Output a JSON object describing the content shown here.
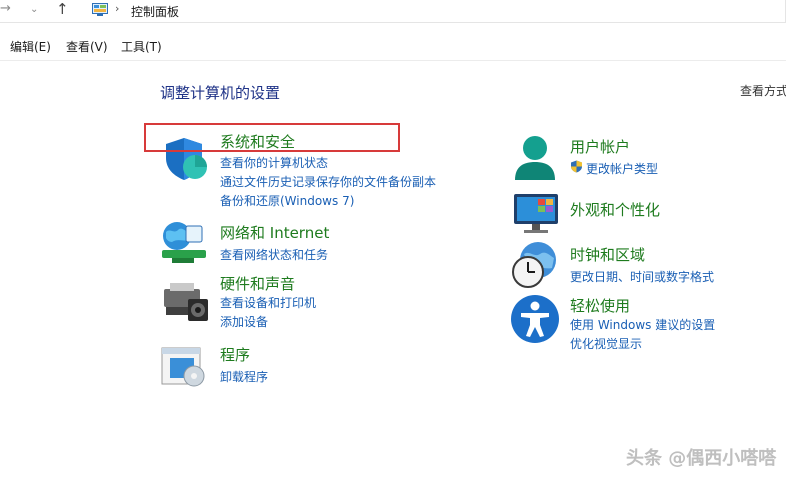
{
  "nav": {
    "forward_glyph": "→",
    "dropdown_glyph": "⌄",
    "up_glyph": "↑",
    "breadcrumb_sep": "›",
    "location": "控制面板"
  },
  "menu": {
    "edit": "编辑(E)",
    "view": "查看(V)",
    "tools": "工具(T)"
  },
  "main": {
    "heading": "调整计算机的设置",
    "view_by": "查看方式"
  },
  "categories": {
    "system_security": {
      "title": "系统和安全",
      "links": [
        "查看你的计算机状态",
        "通过文件历史记录保存你的文件备份副本",
        "备份和还原(Windows 7)"
      ]
    },
    "network": {
      "title": "网络和 Internet",
      "links": [
        "查看网络状态和任务"
      ]
    },
    "hardware": {
      "title": "硬件和声音",
      "links": [
        "查看设备和打印机",
        "添加设备"
      ]
    },
    "programs": {
      "title": "程序",
      "links": [
        "卸载程序"
      ]
    },
    "user_accounts": {
      "title": "用户帐户",
      "links": [
        "更改帐户类型"
      ]
    },
    "appearance": {
      "title": "外观和个性化",
      "links": []
    },
    "clock_region": {
      "title": "时钟和区域",
      "links": [
        "更改日期、时间或数字格式"
      ]
    },
    "ease_of_access": {
      "title": "轻松使用",
      "links": [
        "使用 Windows 建议的设置",
        "优化视觉显示"
      ]
    }
  },
  "watermark": "头条 @偶西小嗒嗒",
  "colors": {
    "category_title": "#1e7b1e",
    "link": "#1a5fb4",
    "heading": "#1e3287",
    "highlight": "#d73a3a"
  },
  "icons": [
    "shield-icon",
    "network-globe-icon",
    "printer-icon",
    "programs-icon",
    "user-icon",
    "monitor-icon",
    "clock-globe-icon",
    "accessibility-icon",
    "uac-shield-icon",
    "control-panel-icon"
  ]
}
